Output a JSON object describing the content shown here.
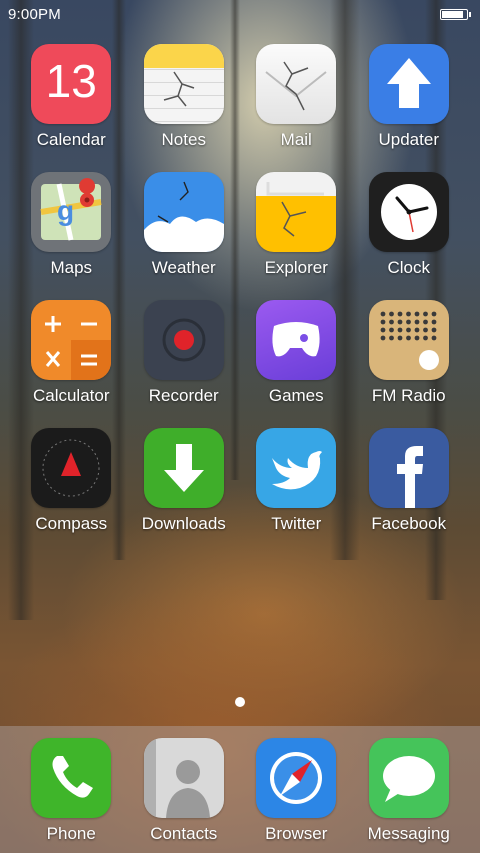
{
  "status_bar": {
    "time": "9:00PM",
    "battery_level": 0.92
  },
  "apps": [
    {
      "label": "Calendar",
      "icon": "calendar-icon",
      "date": "13"
    },
    {
      "label": "Notes",
      "icon": "notes-icon"
    },
    {
      "label": "Mail",
      "icon": "mail-icon"
    },
    {
      "label": "Updater",
      "icon": "updater-icon"
    },
    {
      "label": "Maps",
      "icon": "maps-icon"
    },
    {
      "label": "Weather",
      "icon": "weather-icon"
    },
    {
      "label": "Explorer",
      "icon": "explorer-icon"
    },
    {
      "label": "Clock",
      "icon": "clock-icon"
    },
    {
      "label": "Calculator",
      "icon": "calculator-icon"
    },
    {
      "label": "Recorder",
      "icon": "recorder-icon"
    },
    {
      "label": "Games",
      "icon": "games-icon"
    },
    {
      "label": "FM Radio",
      "icon": "radio-icon"
    },
    {
      "label": "Compass",
      "icon": "compass-icon"
    },
    {
      "label": "Downloads",
      "icon": "downloads-icon"
    },
    {
      "label": "Twitter",
      "icon": "twitter-icon"
    },
    {
      "label": "Facebook",
      "icon": "facebook-icon"
    }
  ],
  "page_indicator": {
    "pages": 1,
    "current": 1
  },
  "dock": [
    {
      "label": "Phone",
      "icon": "phone-icon"
    },
    {
      "label": "Contacts",
      "icon": "contacts-icon"
    },
    {
      "label": "Browser",
      "icon": "browser-icon"
    },
    {
      "label": "Messaging",
      "icon": "messaging-icon"
    }
  ],
  "colors": {
    "calendar": "#ef4a5a",
    "notes_top": "#fbd54a",
    "updater": "#3a7ee6",
    "weather": "#3a8ee8",
    "explorer": "#ffc000",
    "calculator": "#f08a2a",
    "recorder": "#3b4250",
    "games": "#7b4ee6",
    "radio": "#d9b57a",
    "downloads": "#3fae2a",
    "twitter": "#37a6e6",
    "facebook": "#3a5ba0",
    "phone": "#3fb52a",
    "browser": "#2c86e6",
    "messaging": "#45c45a"
  }
}
